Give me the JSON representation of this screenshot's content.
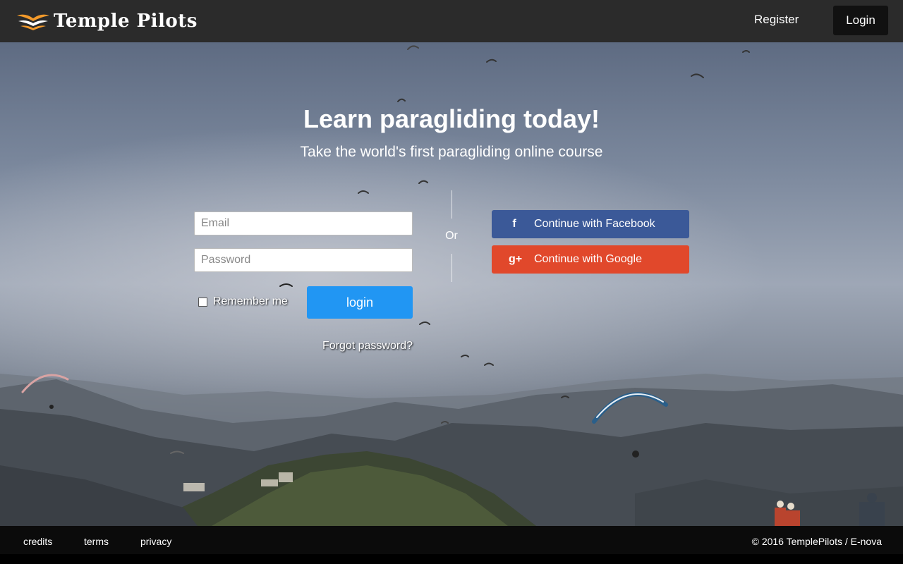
{
  "header": {
    "brand": "Temple Pilots",
    "register_label": "Register",
    "login_label": "Login"
  },
  "hero": {
    "title": "Learn paragliding today!",
    "subtitle": "Take the world's first paragliding online course"
  },
  "form": {
    "email_placeholder": "Email",
    "password_placeholder": "Password",
    "remember_label": "Remember me",
    "login_button": "login",
    "forgot_link": "Forgot password?",
    "divider_text": "Or"
  },
  "social": {
    "facebook_label": "Continue with Facebook",
    "facebook_icon": "f",
    "google_label": "Continue with Google",
    "google_icon": "g+"
  },
  "footer": {
    "links": [
      "credits",
      "terms",
      "privacy"
    ],
    "copyright": "© 2016 TemplePilots / E-nova"
  },
  "colors": {
    "header_bg": "#2b2b2b",
    "login_button": "#2196f3",
    "facebook": "#3b5998",
    "google": "#e1482b",
    "logo_accent": "#f39a2b"
  }
}
